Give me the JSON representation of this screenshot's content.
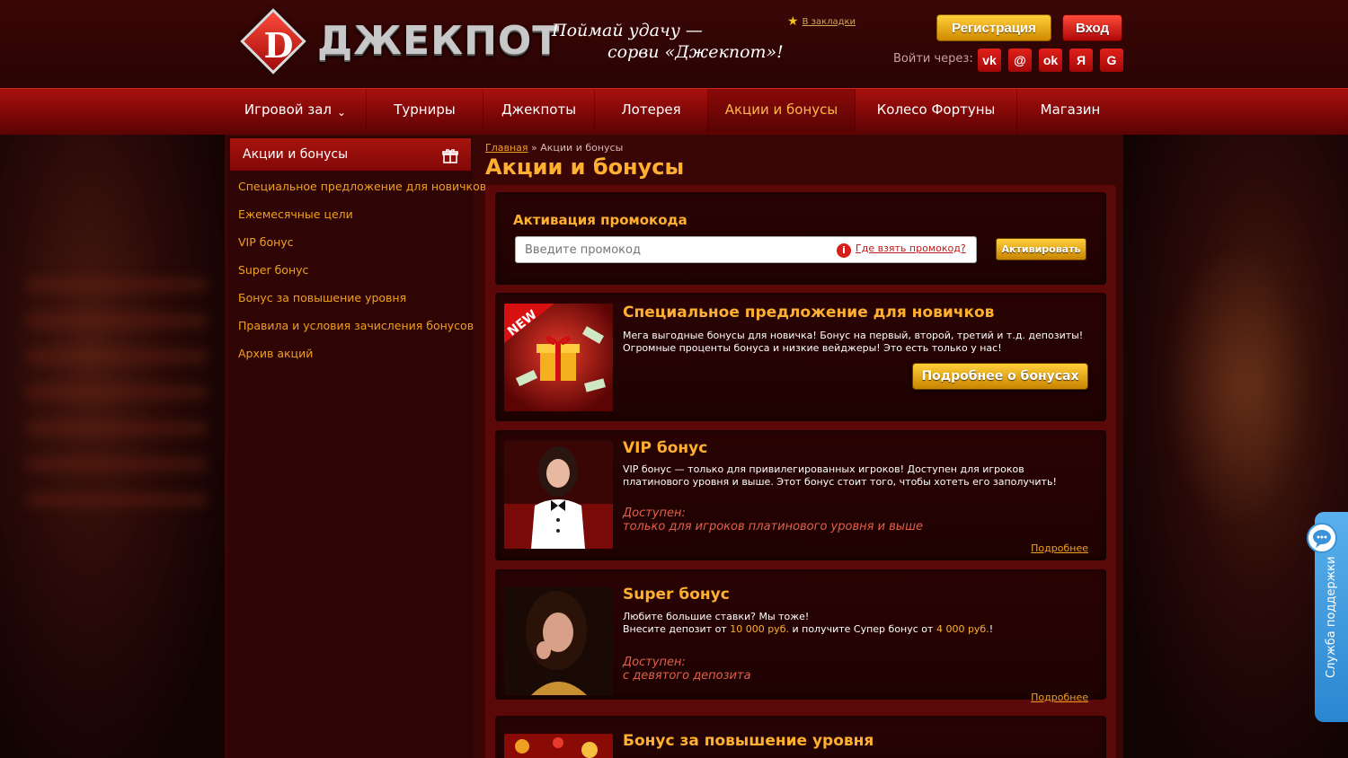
{
  "header": {
    "logo_letter": "D",
    "logo_text": "ДЖЕКПОТ",
    "slogan_line1": "Поймай удачу —",
    "slogan_line2": "сорви «Джекпот»!",
    "bookmark": "В закладки",
    "register": "Регистрация",
    "login": "Вход",
    "social_label": "Войти через:",
    "social": [
      "vk",
      "@",
      "ok",
      "Я",
      "G"
    ]
  },
  "nav": {
    "items": [
      "Игровой зал",
      "Турниры",
      "Джекпоты",
      "Лотерея",
      "Акции и бонусы",
      "Колесо Фортуны",
      "Магазин"
    ],
    "active": "Акции и бонусы"
  },
  "sidebar": {
    "title": "Акции и бонусы",
    "links": [
      "Специальное предложение для новичков",
      "Ежемесячные цели",
      "VIP бонус",
      "Super бонус",
      "Бонус за повышение уровня",
      "Правила и условия зачисления бонусов",
      "Архив акций"
    ]
  },
  "breadcrumb": {
    "home": "Главная",
    "sep": "»",
    "current": "Акции и бонусы"
  },
  "page_title": "Акции и бонусы",
  "promo": {
    "title": "Активация промокода",
    "placeholder": "Введите промокод",
    "where": "Где взять промокод?",
    "activate": "Активировать"
  },
  "cards": {
    "newbie": {
      "badge": "NEW",
      "title": "Специальное предложение для новичков",
      "text": "Мега выгодные бонусы для новичка! Бонус на первый, второй, третий и т.д. депозиты! Огромные проценты бонуса и низкие вейджеры! Это есть только у нас!",
      "button": "Подробнее о бонусах"
    },
    "vip": {
      "title": "VIP бонус",
      "text": "VIP бонус — только для привилегированных игроков! Доступен для игроков платинового уровня и выше. Этот бонус стоит того, чтобы хотеть его заполучить!",
      "avail_label": "Доступен:",
      "avail_value": "только для игроков платинового уровня и выше",
      "more": "Подробнее"
    },
    "super": {
      "title": "Super бонус",
      "line1": "Любите большие ставки? Мы тоже!",
      "line2_a": "Внесите депозит от",
      "amount1": "10 000 руб.",
      "line2_b": "и получите Супер бонус от",
      "amount2": "4 000 руб.",
      "line2_c": "!",
      "avail_label": "Доступен:",
      "avail_value": "с девятого депозита",
      "more": "Подробнее"
    },
    "levelup": {
      "title": "Бонус за повышение уровня"
    }
  },
  "support": {
    "label": "Служба поддержки"
  },
  "colors": {
    "accent": "#ffb030",
    "brand_red": "#a8120e",
    "link": "#f0a020"
  }
}
